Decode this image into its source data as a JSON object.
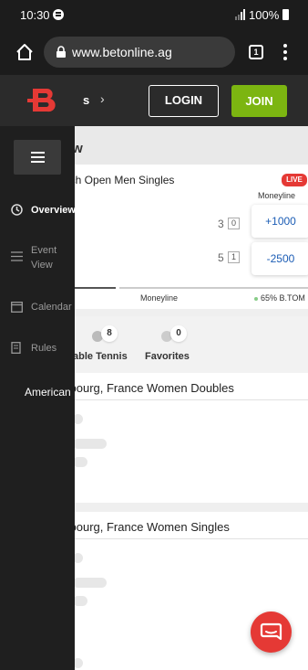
{
  "status_bar": {
    "time": "10:30",
    "battery": "100%"
  },
  "browser": {
    "url": "www.betonline.ag",
    "tab_count": "1"
  },
  "header": {
    "crumb": "s",
    "login_label": "LOGIN",
    "join_label": "JOIN"
  },
  "sidebar": {
    "items": [
      {
        "label": "Overview"
      },
      {
        "label": "Event View"
      },
      {
        "label": "Calendar"
      },
      {
        "label": "Rules"
      }
    ],
    "odds_format": "American"
  },
  "content": {
    "section_title": "ow",
    "match": {
      "title": "nch Open Men Singles",
      "live_badge": "LIVE",
      "column_label": "Moneyline",
      "player1_score": "3",
      "player1_games": "0",
      "player1_odds": "+1000",
      "player2_score": "5",
      "player2_games": "1",
      "player2_odds": "-2500",
      "bottom_market": "Moneyline",
      "bottom_pct": "65% B.TOM"
    },
    "sport_tabs": [
      {
        "label": "able Tennis",
        "count": "8"
      },
      {
        "label": "Favorites",
        "count": "0"
      }
    ],
    "events": [
      {
        "title": "sbourg, France Women Doubles"
      },
      {
        "title": "sbourg, France Women Singles"
      }
    ]
  },
  "colors": {
    "brand_red": "#e53935",
    "join_green": "#7cb511",
    "odds_blue": "#1c5db5"
  }
}
